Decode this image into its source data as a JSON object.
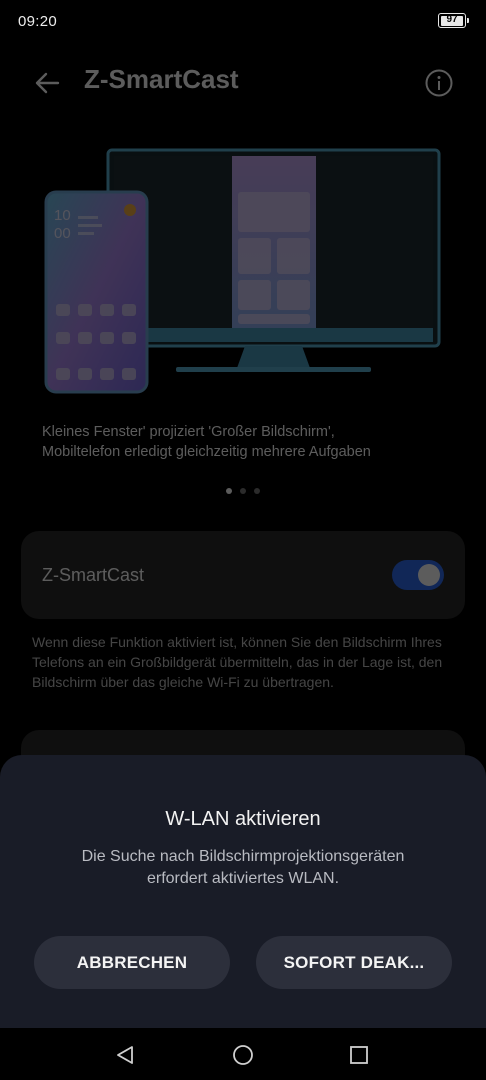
{
  "status_bar": {
    "time": "09:20",
    "battery_level": "97",
    "battery_fraction": 0.97
  },
  "header": {
    "title": "Z-SmartCast",
    "back_icon": "arrow-left-icon",
    "info_icon": "info-circle-icon"
  },
  "illustration": {
    "phone_time_hours": "10",
    "phone_time_minutes": "00"
  },
  "caption": {
    "line1": "Kleines Fenster' projiziert 'Großer Bildschirm',",
    "line2": "Mobiltelefon erledigt gleichzeitig mehrere Aufgaben"
  },
  "pager": {
    "count": 3,
    "active_index": 0
  },
  "toggle_setting": {
    "label": "Z-SmartCast",
    "enabled": true
  },
  "description": "Wenn diese Funktion aktiviert ist, können Sie den Bildschirm Ihres Telefons an ein Großbildgerät übermitteln, das in der Lage ist, den Bildschirm über das gleiche Wi-Fi zu übertragen.",
  "dialog": {
    "title": "W-LAN aktivieren",
    "message_line1": "Die Suche nach Bildschirmprojektionsgeräten",
    "message_line2": "erfordert aktiviertes WLAN.",
    "cancel_label": "ABBRECHEN",
    "confirm_label": "SOFORT DEAK..."
  },
  "nav_bar": {
    "back_icon": "triangle-back-icon",
    "home_icon": "circle-home-icon",
    "recents_icon": "square-recents-icon"
  },
  "colors": {
    "accent": "#2f6df1",
    "dialog_bg": "#191c27",
    "button_bg": "#2c2f3b",
    "monitor": "#5aaed0"
  }
}
